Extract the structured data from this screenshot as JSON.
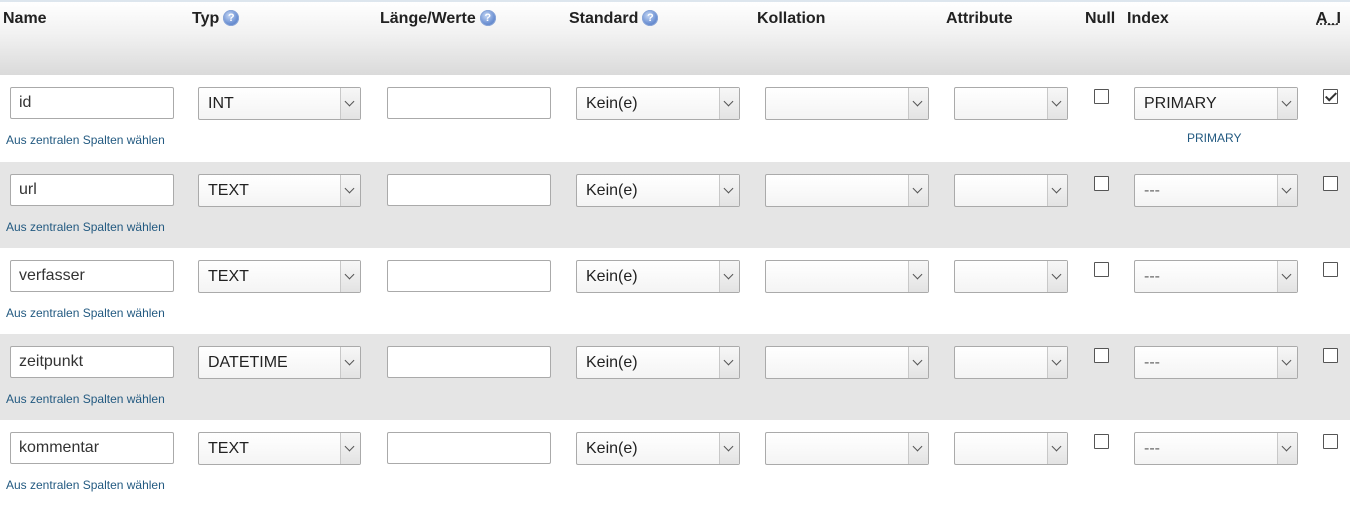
{
  "headers": {
    "name": "Name",
    "typ": "Typ",
    "laenge": "Länge/Werte",
    "standard": "Standard",
    "kollation": "Kollation",
    "attribute": "Attribute",
    "null": "Null",
    "index": "Index",
    "ai": "A_I"
  },
  "help_glyph": "?",
  "central_columns_link": "Aus zentralen Spalten wählen",
  "rows": [
    {
      "name": "id",
      "type": "INT",
      "length": "",
      "default": "Kein(e)",
      "collation": "",
      "attribute": "",
      "null": false,
      "index": "PRIMARY",
      "index_label": "PRIMARY",
      "ai": true
    },
    {
      "name": "url",
      "type": "TEXT",
      "length": "",
      "default": "Kein(e)",
      "collation": "",
      "attribute": "",
      "null": false,
      "index": "---",
      "index_label": "",
      "ai": false
    },
    {
      "name": "verfasser",
      "type": "TEXT",
      "length": "",
      "default": "Kein(e)",
      "collation": "",
      "attribute": "",
      "null": false,
      "index": "---",
      "index_label": "",
      "ai": false
    },
    {
      "name": "zeitpunkt",
      "type": "DATETIME",
      "length": "",
      "default": "Kein(e)",
      "collation": "",
      "attribute": "",
      "null": false,
      "index": "---",
      "index_label": "",
      "ai": false
    },
    {
      "name": "kommentar",
      "type": "TEXT",
      "length": "",
      "default": "Kein(e)",
      "collation": "",
      "attribute": "",
      "null": false,
      "index": "---",
      "index_label": "",
      "ai": false
    }
  ]
}
